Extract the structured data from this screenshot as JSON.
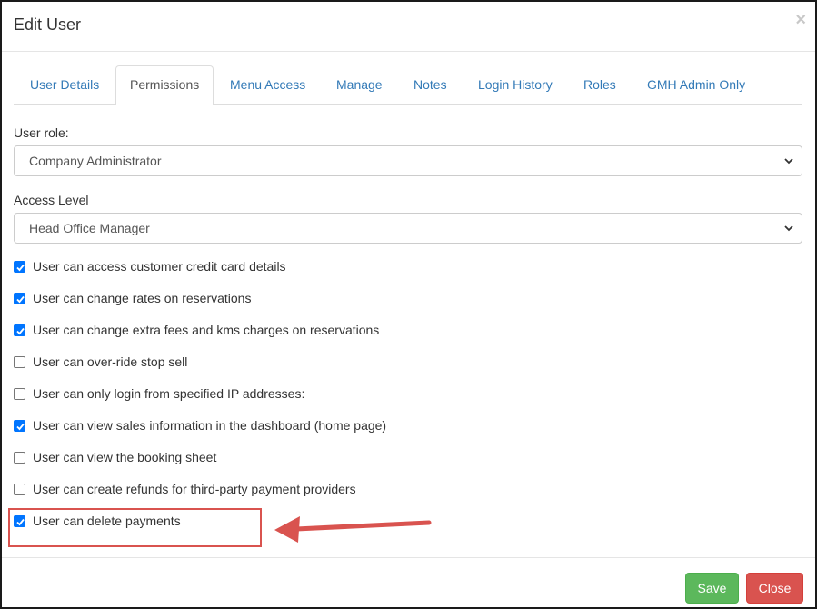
{
  "modal": {
    "title": "Edit User",
    "close_glyph": "×"
  },
  "tabs": [
    {
      "label": "User Details",
      "active": false
    },
    {
      "label": "Permissions",
      "active": true
    },
    {
      "label": "Menu Access",
      "active": false
    },
    {
      "label": "Manage",
      "active": false
    },
    {
      "label": "Notes",
      "active": false
    },
    {
      "label": "Login History",
      "active": false
    },
    {
      "label": "Roles",
      "active": false
    },
    {
      "label": "GMH Admin Only",
      "active": false
    }
  ],
  "fields": {
    "user_role_label": "User role:",
    "user_role_value": "Company Administrator",
    "access_level_label": "Access Level",
    "access_level_value": "Head Office Manager"
  },
  "permissions": [
    {
      "label": "User can access customer credit card details",
      "checked": true
    },
    {
      "label": "User can change rates on reservations",
      "checked": true
    },
    {
      "label": "User can change extra fees and kms charges on reservations",
      "checked": true
    },
    {
      "label": "User can over-ride stop sell",
      "checked": false
    },
    {
      "label": "User can only login from specified IP addresses:",
      "checked": false
    },
    {
      "label": "User can view sales information in the dashboard (home page)",
      "checked": true
    },
    {
      "label": "User can view the booking sheet",
      "checked": false
    },
    {
      "label": "User can create refunds for third-party payment providers",
      "checked": false
    },
    {
      "label": "User can delete payments",
      "checked": true
    }
  ],
  "footer": {
    "save_label": "Save",
    "close_label": "Close"
  },
  "colors": {
    "link": "#337ab7",
    "save": "#5cb85c",
    "close": "#d9534f",
    "annotation": "#d9534f",
    "checkbox": "#0075ff"
  }
}
